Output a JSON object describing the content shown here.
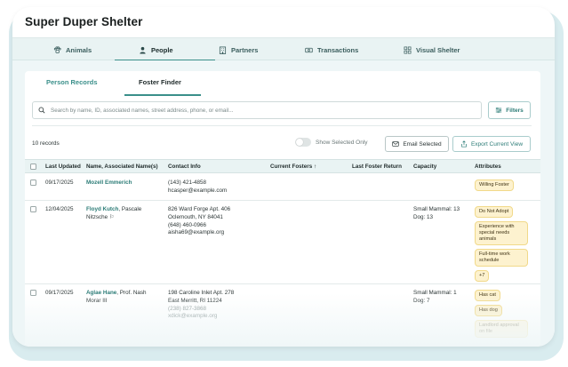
{
  "app": {
    "title": "Super Duper Shelter"
  },
  "nav": {
    "items": [
      {
        "label": "Animals",
        "icon": "paw-icon"
      },
      {
        "label": "People",
        "icon": "person-icon"
      },
      {
        "label": "Partners",
        "icon": "building-icon"
      },
      {
        "label": "Transactions",
        "icon": "cash-icon"
      },
      {
        "label": "Visual Shelter",
        "icon": "grid-icon"
      }
    ],
    "active": "People"
  },
  "subtabs": {
    "items": [
      "Person Records",
      "Foster Finder"
    ],
    "active": "Foster Finder"
  },
  "search": {
    "placeholder": "Search by name, ID, associated names, street address, phone, or email..."
  },
  "toolbar": {
    "filters_label": "Filters",
    "records_count": "10 records",
    "show_selected_label": "Show Selected Only",
    "email_selected_label": "Email Selected",
    "export_label": "Export Current View"
  },
  "table": {
    "columns": [
      "Last Updated",
      "Name, Associated Name(s)",
      "Contact Info",
      "Current Fosters ↑",
      "Last Foster Return",
      "Capacity",
      "Attributes"
    ],
    "rows": [
      {
        "last_updated": "09/17/2025",
        "name": "Mozell Emmerich",
        "assoc": "",
        "contact": [
          "(143) 421-4858",
          "hcasper@example.com"
        ],
        "capacity": [],
        "attributes": [
          "Willing Foster"
        ]
      },
      {
        "last_updated": "12/04/2025",
        "name": "Floyd Kutch",
        "assoc": ", Pascale Nitzsche ⚐",
        "contact": [
          "826 Ward Forge Apt. 406",
          "Oclemouth, NY 84041",
          "(648) 460-0966",
          "aisha69@example.org"
        ],
        "capacity": [
          "Small Mammal: 13",
          "Dog: 13"
        ],
        "attributes": [
          "Do Not Adopt",
          "Experience with special needs animals",
          "Full-time work schedule",
          "+7"
        ]
      },
      {
        "last_updated": "09/17/2025",
        "name": "Aglae Hane",
        "assoc": ", Prof. Nash Morar III",
        "contact": [
          "198 Caroline Inlet Apt. 278",
          "East Merritt, RI 11224",
          "(238) 827-3868",
          "xdick@example.org"
        ],
        "capacity": [
          "Small Mammal: 1",
          "Dog: 7"
        ],
        "attributes": [
          "Has cat",
          "Has dog",
          "Landlord approval on file"
        ]
      }
    ]
  },
  "colors": {
    "accent": "#3a8f8a",
    "badge_bg": "#fdf2cf",
    "nav_bg": "#e9f3f3"
  }
}
